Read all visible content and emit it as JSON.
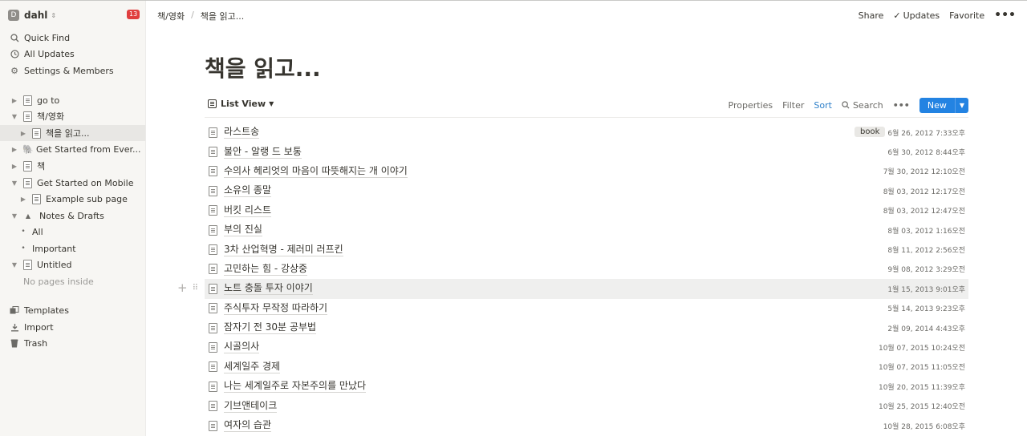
{
  "workspace": {
    "avatar": "D",
    "name": "dahl",
    "badge": "13"
  },
  "sidebar": {
    "top_items": [
      {
        "label": "Quick Find",
        "icon": "search-icon"
      },
      {
        "label": "All Updates",
        "icon": "clock-icon"
      },
      {
        "label": "Settings & Members",
        "icon": "gear-icon"
      }
    ],
    "pages": [
      {
        "label": "go to"
      },
      {
        "label": "책/영화"
      },
      {
        "label": "책을 읽고..."
      },
      {
        "label": "Get Started from Ever..."
      },
      {
        "label": "책"
      },
      {
        "label": "Get Started on Mobile"
      },
      {
        "label": "Example sub page"
      },
      {
        "label": "Notes & Drafts"
      },
      {
        "label": "All"
      },
      {
        "label": "Important"
      },
      {
        "label": "Untitled"
      },
      {
        "label": "No pages inside"
      }
    ],
    "bottom_items": [
      {
        "label": "Templates",
        "icon": "templates-icon"
      },
      {
        "label": "Import",
        "icon": "import-icon"
      },
      {
        "label": "Trash",
        "icon": "trash-icon"
      }
    ]
  },
  "breadcrumb": {
    "parent": "책/영화",
    "separator": "/",
    "current": "책을 읽고..."
  },
  "topbar": {
    "share": "Share",
    "updates": "Updates",
    "favorite": "Favorite",
    "more": "•••"
  },
  "page": {
    "title": "책을 읽고..."
  },
  "toolbar": {
    "view": "List View",
    "properties": "Properties",
    "filter": "Filter",
    "sort": "Sort",
    "search": "Search",
    "more": "•••",
    "new": "New"
  },
  "rows": [
    {
      "title": "라스트송",
      "tag": "book",
      "date": "6월 26, 2012 7:33오후"
    },
    {
      "title": "불안 - 알랭 드 보통",
      "date": "6월 30, 2012 8:44오후"
    },
    {
      "title": "수의사 헤리엇의 마음이 따뜻해지는 개 이야기",
      "date": "7월 30, 2012 12:10오전"
    },
    {
      "title": "소유의 종말",
      "date": "8월 03, 2012 12:17오전"
    },
    {
      "title": "버킷 리스트",
      "date": "8월 03, 2012 12:47오전"
    },
    {
      "title": "부의 진실",
      "date": "8월 03, 2012 1:16오전"
    },
    {
      "title": "3차 산업혁명 - 제러미 러프킨",
      "date": "8월 11, 2012 2:56오전"
    },
    {
      "title": "고민하는 힘 - 강상중",
      "date": "9월 08, 2012 3:29오전"
    },
    {
      "title": "노트 충돌 투자 이야기",
      "date": "1월 15, 2013 9:01오후"
    },
    {
      "title": "주식투자 무작정 따라하기",
      "date": "5월 14, 2013 9:23오후"
    },
    {
      "title": "잠자기 전 30분 공부법",
      "date": "2월 09, 2014 4:43오후"
    },
    {
      "title": "시골의사",
      "date": "10월 07, 2015 10:24오전"
    },
    {
      "title": "세계일주 경제",
      "date": "10월 07, 2015 11:05오전"
    },
    {
      "title": "나는 세계일주로 자본주의를 만났다",
      "date": "10월 20, 2015 11:39오후"
    },
    {
      "title": "기브앤테이크",
      "date": "10월 25, 2015 12:40오전"
    },
    {
      "title": "여자의 습관",
      "date": "10월 28, 2015 6:08오후"
    }
  ],
  "colors": {
    "accent": "#2383e2",
    "sort": "#2f80c9",
    "badge": "#e03e3e",
    "sidebar": "#f7f6f3"
  }
}
